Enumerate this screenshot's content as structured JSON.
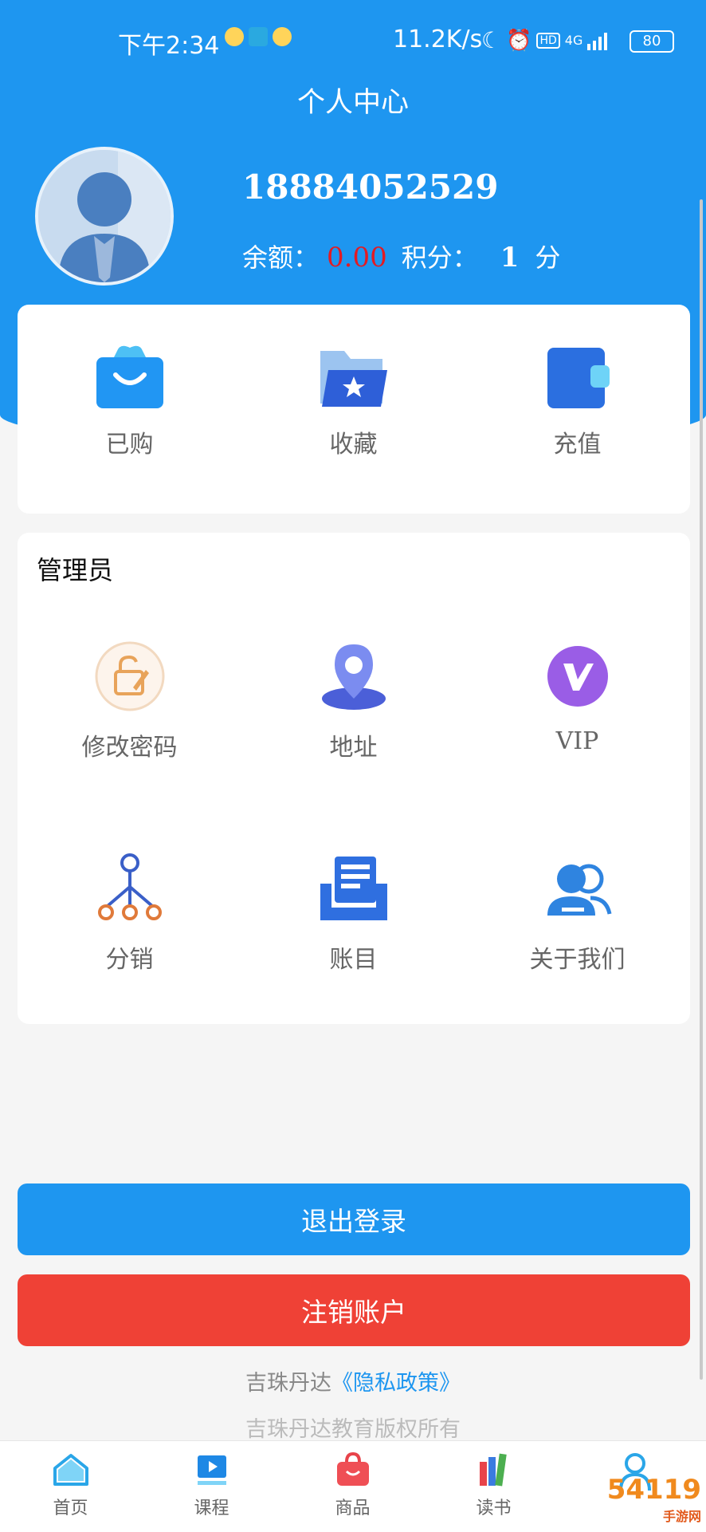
{
  "status_bar": {
    "time": "下午2:34",
    "network_speed": "11.2K/s",
    "signal": "4G",
    "battery": "80"
  },
  "header": {
    "title": "个人中心"
  },
  "profile": {
    "phone": "18884052529",
    "balance_label": "余额：",
    "balance_value": "0.00",
    "points_label": "积分：",
    "points_value": "1",
    "points_unit": "分"
  },
  "quick_actions": [
    {
      "label": "已购",
      "icon": "shopping-bag-icon"
    },
    {
      "label": "收藏",
      "icon": "folder-star-icon"
    },
    {
      "label": "充值",
      "icon": "wallet-icon"
    }
  ],
  "admin": {
    "title": "管理员",
    "items": [
      {
        "label": "修改密码",
        "icon": "edit-lock-icon"
      },
      {
        "label": "地址",
        "icon": "location-pin-icon"
      },
      {
        "label": "VIP",
        "icon": "vip-icon"
      },
      {
        "label": "分销",
        "icon": "distribution-tree-icon"
      },
      {
        "label": "账目",
        "icon": "ledger-icon"
      },
      {
        "label": "关于我们",
        "icon": "about-users-icon"
      }
    ]
  },
  "buttons": {
    "logout": "退出登录",
    "delete_account": "注销账户"
  },
  "footer": {
    "privacy_prefix": "吉珠丹达",
    "privacy_link": "《隐私政策》",
    "copyright": "吉珠丹达教育版权所有"
  },
  "tabbar": [
    {
      "label": "首页",
      "icon": "home-icon"
    },
    {
      "label": "课程",
      "icon": "video-course-icon"
    },
    {
      "label": "商品",
      "icon": "shop-bag-icon"
    },
    {
      "label": "读书",
      "icon": "books-icon"
    },
    {
      "label": "",
      "icon": "user-icon",
      "active": true
    }
  ],
  "watermark": {
    "brand": "54119",
    "sub": "手游网"
  },
  "colors": {
    "primary": "#1e96f0",
    "danger": "#ef4136",
    "balance": "#e31b23"
  }
}
